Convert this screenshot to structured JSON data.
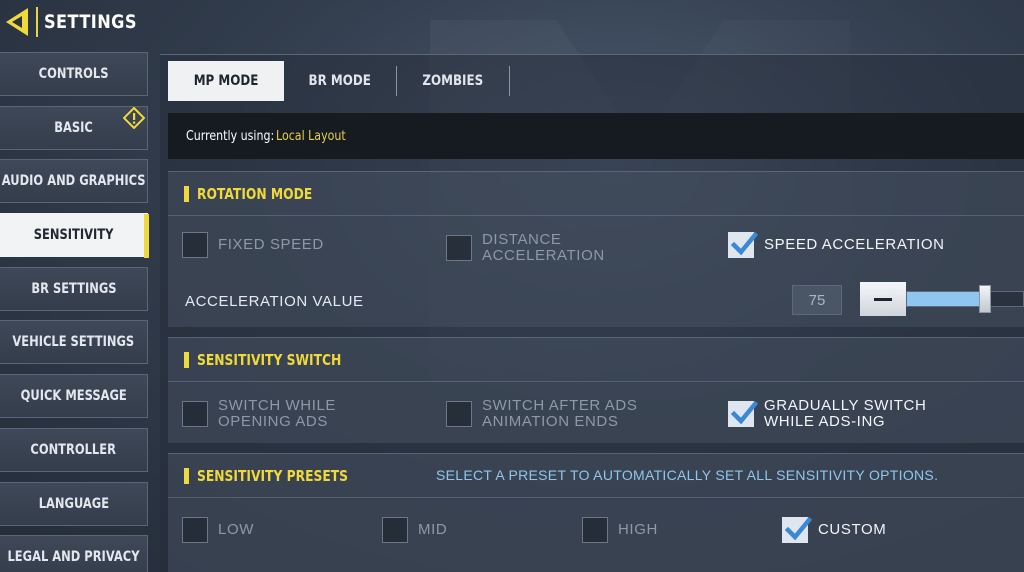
{
  "header": {
    "title": "SETTINGS",
    "back_icon": "back-arrow-icon"
  },
  "accent_color": "#f0d93a",
  "sidebar": {
    "items": [
      {
        "label": "CONTROLS",
        "active": false
      },
      {
        "label": "BASIC",
        "active": false,
        "badge": "warning-icon"
      },
      {
        "label": "AUDIO AND GRAPHICS",
        "active": false
      },
      {
        "label": "SENSITIVITY",
        "active": true
      },
      {
        "label": "BR SETTINGS",
        "active": false
      },
      {
        "label": "VEHICLE SETTINGS",
        "active": false
      },
      {
        "label": "QUICK MESSAGE",
        "active": false
      },
      {
        "label": "CONTROLLER",
        "active": false
      },
      {
        "label": "LANGUAGE",
        "active": false
      },
      {
        "label": "LEGAL AND PRIVACY",
        "active": false
      }
    ]
  },
  "tabs": [
    {
      "label": "MP MODE",
      "active": true
    },
    {
      "label": "BR MODE",
      "active": false
    },
    {
      "label": "ZOMBIES",
      "active": false
    }
  ],
  "layout_status": {
    "prefix": "Currently using:",
    "value": "Local Layout"
  },
  "rotation_mode": {
    "title": "ROTATION MODE",
    "options": [
      {
        "label": "FIXED SPEED",
        "checked": false
      },
      {
        "label": "DISTANCE\nACCELERATION",
        "checked": false
      },
      {
        "label": "SPEED ACCELERATION",
        "checked": true
      }
    ],
    "acceleration_label": "ACCELERATION VALUE",
    "acceleration_value": "75",
    "acceleration_fraction": 0.75
  },
  "sensitivity_switch": {
    "title": "SENSITIVITY SWITCH",
    "options": [
      {
        "label": "SWITCH WHILE\nOPENING ADS",
        "checked": false
      },
      {
        "label": "SWITCH AFTER ADS\nANIMATION ENDS",
        "checked": false
      },
      {
        "label": "GRADUALLY SWITCH\nWHILE ADS-ING",
        "checked": true
      }
    ]
  },
  "sensitivity_presets": {
    "title": "SENSITIVITY PRESETS",
    "hint": "SELECT A PRESET TO AUTOMATICALLY SET ALL SENSITIVITY OPTIONS.",
    "options": [
      {
        "label": "LOW",
        "checked": false
      },
      {
        "label": "MID",
        "checked": false
      },
      {
        "label": "HIGH",
        "checked": false
      },
      {
        "label": "CUSTOM",
        "checked": true
      }
    ]
  }
}
